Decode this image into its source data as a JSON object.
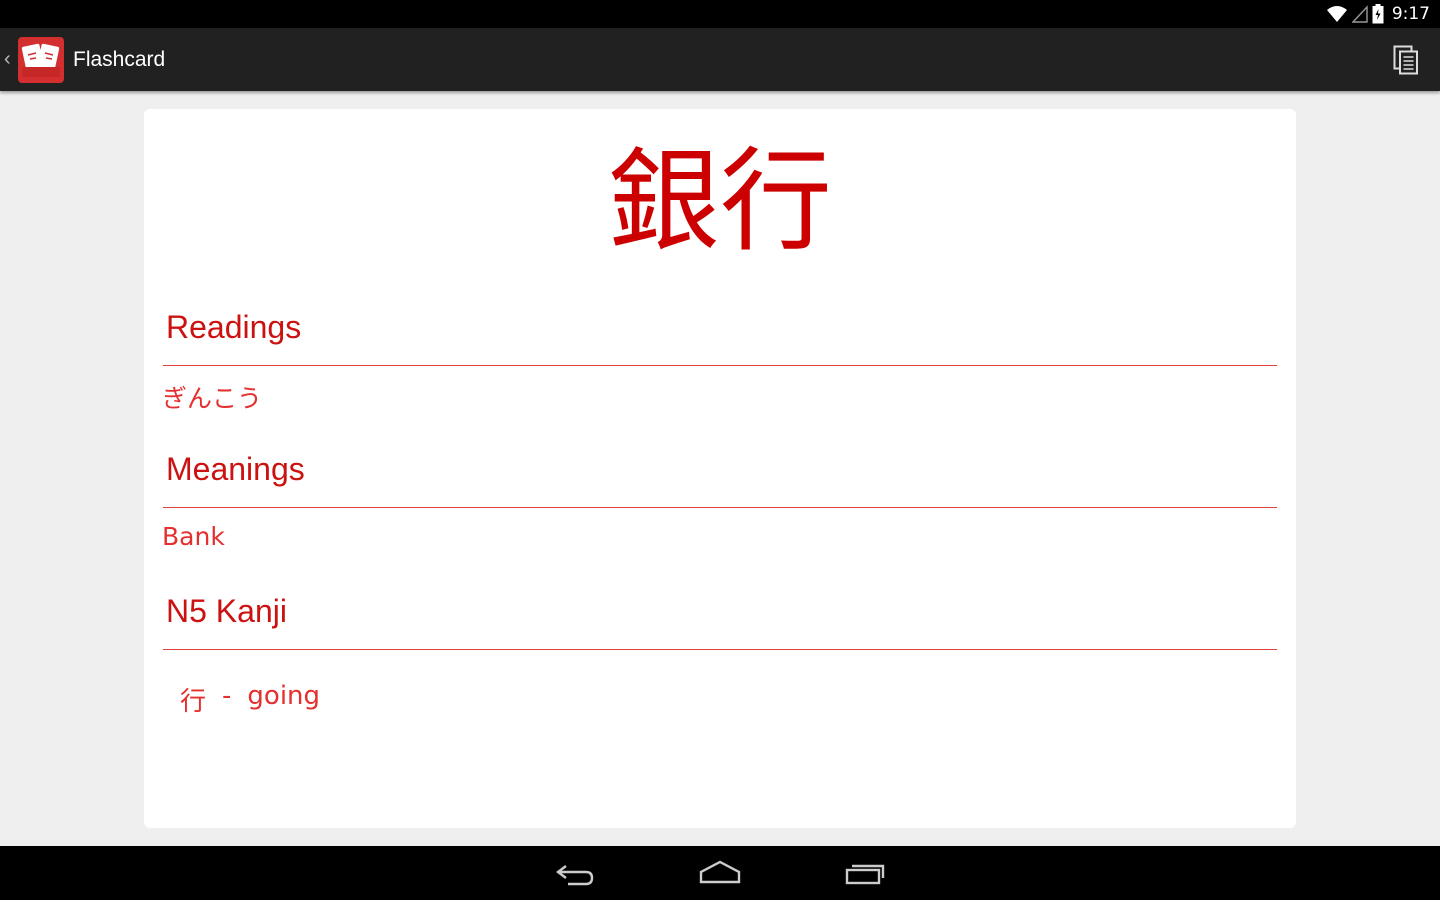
{
  "status_bar": {
    "time": "9:17",
    "icons": [
      "wifi-icon",
      "signal-icon",
      "battery-icon"
    ]
  },
  "action_bar": {
    "title": "Flashcard",
    "logo_icon": "kanji-cards-logo",
    "actions": [
      "copy-icon"
    ]
  },
  "card": {
    "word": "銀行",
    "sections": {
      "readings": {
        "heading": "Readings",
        "value": "ぎんこう"
      },
      "meanings": {
        "heading": "Meanings",
        "value": "Bank"
      },
      "kanji": {
        "heading": "N5 Kanji",
        "items": [
          {
            "kanji": "行",
            "separator": "-",
            "meaning": "going"
          }
        ]
      }
    }
  },
  "nav_bar": {
    "buttons": [
      "back-icon",
      "home-icon",
      "recents-icon"
    ]
  },
  "colors": {
    "accent": "#cc0000",
    "action_bar": "#212121",
    "background": "#efefef"
  }
}
